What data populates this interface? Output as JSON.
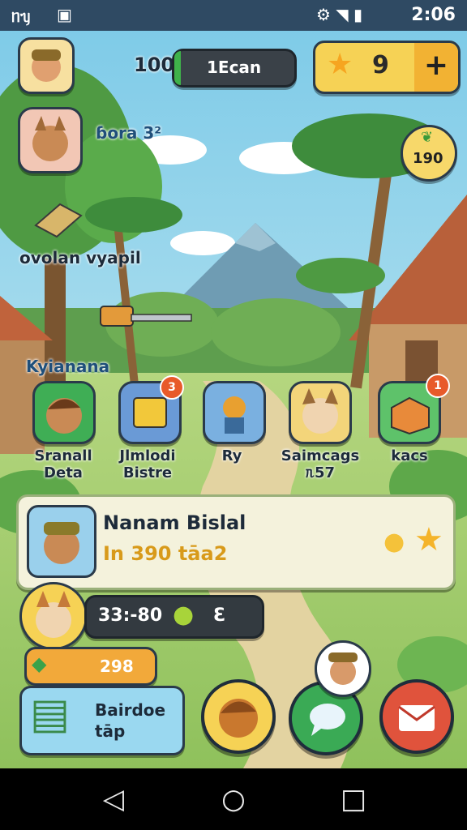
{
  "status_bar": {
    "left_text": "ᥒᥡ",
    "time": "2:06"
  },
  "hud": {
    "level": "100",
    "bar_label": "1Ecan",
    "stars": "9",
    "plus": "+"
  },
  "side": {
    "badge_value": "190"
  },
  "labels": {
    "lost_ora": "ɓora 3²",
    "village_note": "ovolan vyapil",
    "section": "Kyianana"
  },
  "characters": [
    {
      "label_line1": "Sranall",
      "label_line2": "Deta",
      "badge": ""
    },
    {
      "label_line1": "Jlmlodi",
      "label_line2": "Bistre",
      "badge": "3"
    },
    {
      "label_line1": "Ry",
      "label_line2": "",
      "badge": ""
    },
    {
      "label_line1": "Saimcags",
      "label_line2": "ᥰ57",
      "badge": ""
    },
    {
      "label_line1": "kacs",
      "label_line2": "",
      "badge": "1"
    }
  ],
  "quest_card": {
    "title": "Nanam Bislal",
    "subtitle": "In 390 tāa2"
  },
  "bottom": {
    "timer": "33:-80",
    "timer_right": "Ɛ",
    "coins": "298",
    "book_line1": "Bairdoe",
    "book_line2": "tāp"
  },
  "colors": {
    "sky": "#9cd8ee",
    "grass": "#a8cf72",
    "accent_gold": "#f4c23a",
    "teal": "#2aa6a6"
  }
}
